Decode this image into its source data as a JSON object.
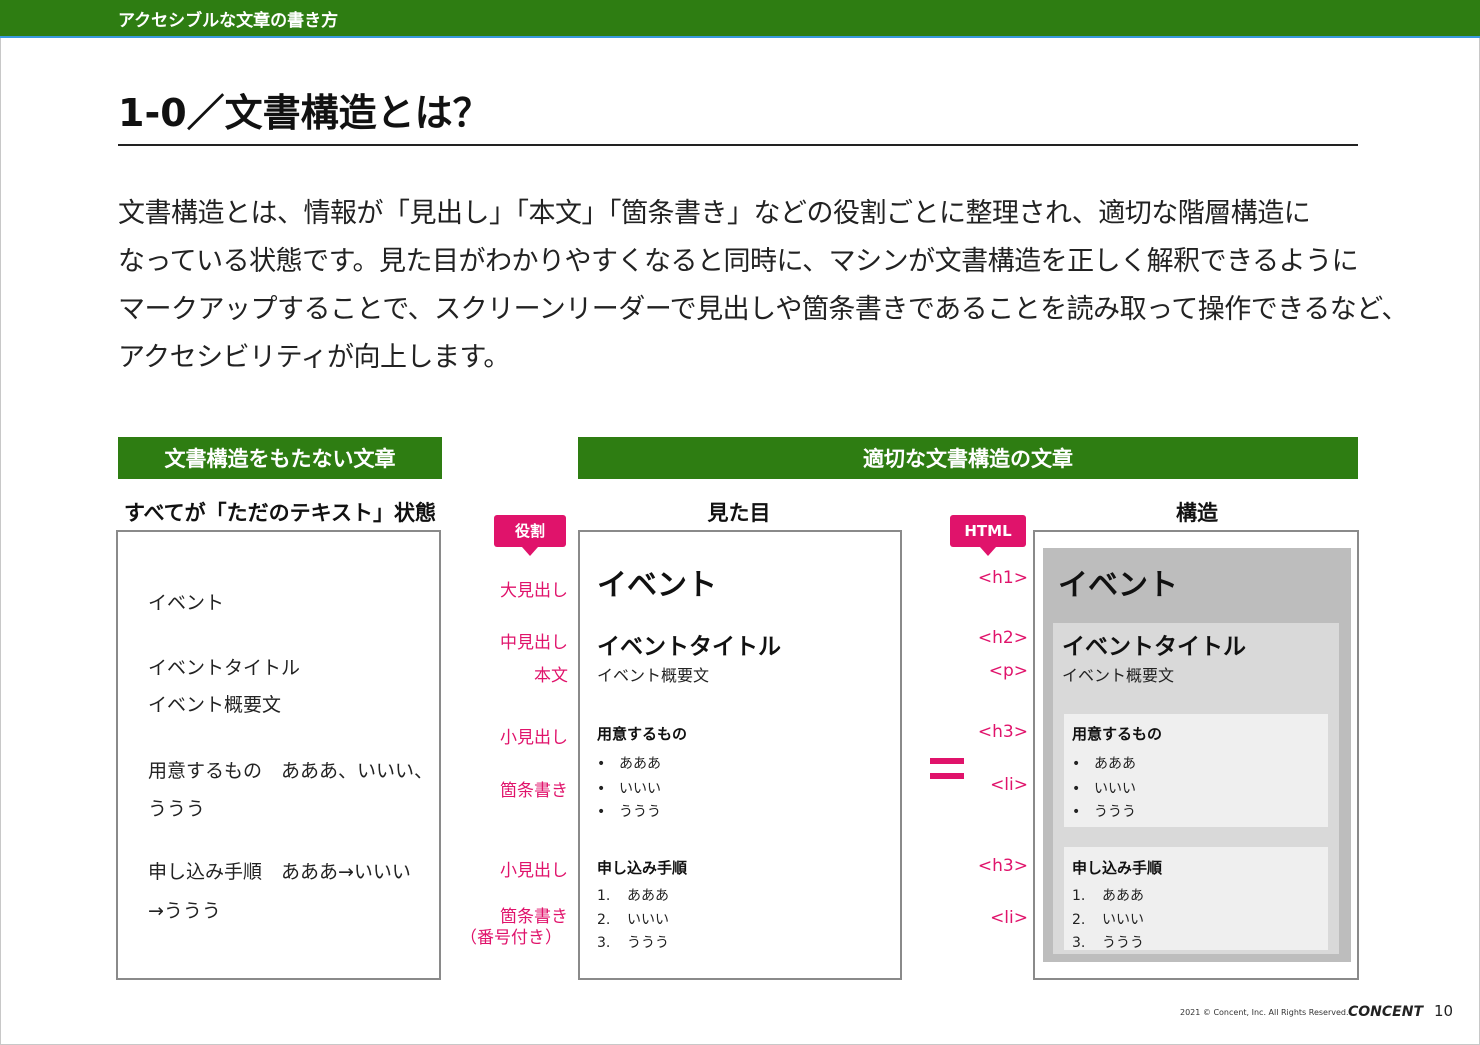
{
  "header": {
    "section": "アクセシブルな文章の書き方"
  },
  "title": "1-0／文書構造とは？",
  "intro_lines": [
    "文書構造とは、情報が「見出し」「本文」「箇条書き」などの役割ごとに整理され、適切な階層構造に",
    "なっている状態です。見た目がわかりやすくなると同時に、マシンが文書構造を正しく解釈できるように",
    "マークアップすることで、スクリーンリーダーで見出しや箇条書きであることを読み取って操作できるなど、",
    "アクセシビリティが向上します。"
  ],
  "left": {
    "heading": "文書構造をもたない文章",
    "subheading": "すべてが「ただのテキスト」状態",
    "lines": [
      "イベント",
      "イベントタイトル",
      "イベント概要文",
      "用意するもの　あああ、いいい、",
      "ううう",
      "申し込み手順　あああ→いいい",
      "→ううう"
    ]
  },
  "right": {
    "heading": "適切な文書構造の文章",
    "col_look": "見た目",
    "col_structure": "構造",
    "tag_role": "役割",
    "tag_html": "HTML"
  },
  "roles": {
    "h1": "大見出し",
    "h2": "中見出し",
    "p": "本文",
    "h3a": "小見出し",
    "li_a": "箇条書き",
    "h3b": "小見出し",
    "li_b1": "箇条書き",
    "li_b2": "（番号付き）"
  },
  "html_tags": {
    "h1": "<h1>",
    "h2": "<h2>",
    "p": "<p>",
    "h3a": "<h3>",
    "li_a": "<li>",
    "h3b": "<h3>",
    "li_b": "<li>"
  },
  "doc": {
    "h1": "イベント",
    "h2": "イベントタイトル",
    "p": "イベント概要文",
    "h3a": "用意するもの",
    "bullet": "•",
    "items_a": [
      "あああ",
      "いいい",
      "ううう"
    ],
    "h3b": "申し込み手順",
    "nums": [
      "1.",
      "2.",
      "3."
    ],
    "items_b": [
      "あああ",
      "いいい",
      "ううう"
    ]
  },
  "footer": {
    "copyright": "2021 © Concent, Inc. All Rights Reserved.",
    "brand": "CONCENT",
    "page": "10"
  },
  "colors": {
    "green": "#2e7d12",
    "accent": "#e0136b"
  }
}
